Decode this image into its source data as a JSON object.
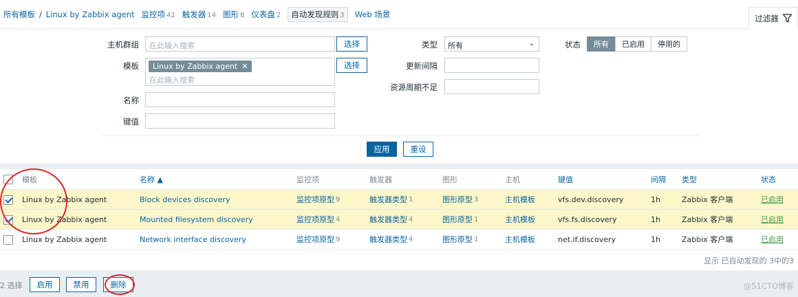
{
  "nav": {
    "breadcrumb_all": "所有模板",
    "separator": "/",
    "template": "Linux by Zabbix agent",
    "tabs": [
      {
        "label": "监控项",
        "count": "42"
      },
      {
        "label": "触发器",
        "count": "14"
      },
      {
        "label": "图形",
        "count": "8"
      },
      {
        "label": "仪表盘",
        "count": "2"
      },
      {
        "label": "自动发现规则",
        "count": "3"
      },
      {
        "label": "Web 场景",
        "count": ""
      }
    ],
    "filter_tab": "过滤器"
  },
  "filter": {
    "host_group_label": "主机群组",
    "host_group_placeholder": "在此输入搜索",
    "select_button": "选择",
    "template_label": "模板",
    "template_tag": "Linux by Zabbix agent",
    "template_placeholder": "在此输入搜索",
    "name_label": "名称",
    "key_label": "键值",
    "type_label": "类型",
    "type_value": "所有",
    "interval_label": "更新间隔",
    "lifetime_label": "资源周期不足",
    "state_label": "状态",
    "state_options": [
      "所有",
      "已启用",
      "停用的"
    ],
    "apply": "应用",
    "reset": "重设"
  },
  "table": {
    "headers": {
      "template": "模板",
      "name": "名称 ▲",
      "items": "监控项",
      "triggers": "触发器",
      "graphs": "图形",
      "hosts": "主机",
      "key": "键值",
      "interval": "间隔",
      "type": "类型",
      "status": "状态"
    },
    "rows": [
      {
        "checked": true,
        "template": "Linux by Zabbix agent",
        "name": "Block devices discovery",
        "items": "监控项原型",
        "items_count": "9",
        "triggers": "触发器类型",
        "triggers_count": "1",
        "graphs": "图形原型",
        "graphs_count": "3",
        "hosts": "主机模板",
        "key": "vfs.dev.discovery",
        "interval": "1h",
        "type": "Zabbix 客户端",
        "status": "已启用"
      },
      {
        "checked": true,
        "template": "Linux by Zabbix agent",
        "name": "Mounted filesystem discovery",
        "items": "监控项原型",
        "items_count": "4",
        "triggers": "触发器类型",
        "triggers_count": "4",
        "graphs": "图形原型",
        "graphs_count": "1",
        "hosts": "主机模板",
        "key": "vfs.fs.discovery",
        "interval": "1h",
        "type": "Zabbix 客户端",
        "status": "已启用"
      },
      {
        "checked": false,
        "template": "Linux by Zabbix agent",
        "name": "Network interface discovery",
        "items": "监控项原型",
        "items_count": "9",
        "triggers": "触发器类型",
        "triggers_count": "4",
        "graphs": "图形原型",
        "graphs_count": "1",
        "hosts": "主机模板",
        "key": "net.if.discovery",
        "interval": "1h",
        "type": "Zabbix 客户端",
        "status": "已启用"
      }
    ],
    "summary": "显示 已自动发现的 3中的3"
  },
  "actions": {
    "selected": "2 选择",
    "enable": "启用",
    "disable": "禁用",
    "delete": "删除"
  },
  "watermark": "@51CTO博客",
  "colors": {
    "accent": "#0a64a0",
    "highlight_row": "#fbf7c9",
    "enabled": "#429e47",
    "annotation": "#e0262d"
  }
}
